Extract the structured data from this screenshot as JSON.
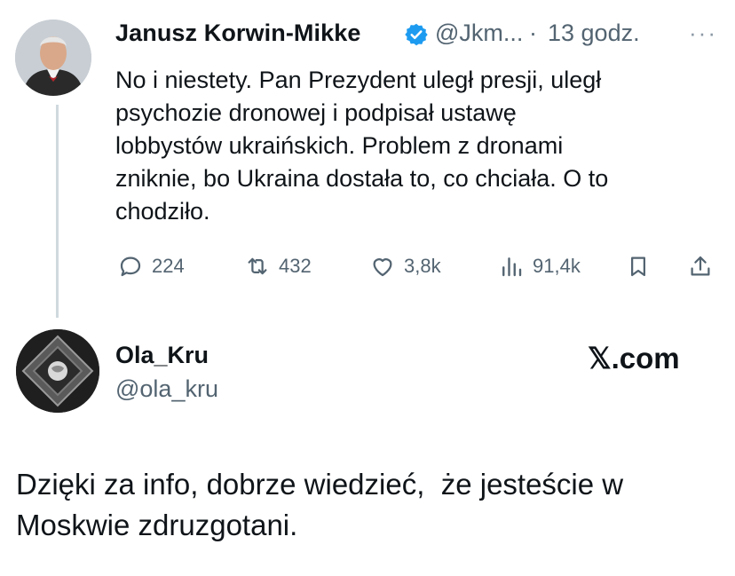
{
  "tweet": {
    "author_name": "Janusz Korwin-Mikke",
    "handle": "@Jkm...",
    "separator": "·",
    "time": "13 godz.",
    "more_label": "···",
    "lines": [
      "No i niestety. Pan Prezydent uległ presji, uległ",
      "psychozie dronowej i podpisał ustawę",
      "lobbystów ukraińskich. Problem z dronami",
      "zniknie, bo Ukraina dostała to, co chciała. O to",
      "chodziło."
    ],
    "replies": "224",
    "reposts": "432",
    "likes": "3,8k",
    "views": "91,4k",
    "icons": [
      "reply-icon",
      "repost-icon",
      "like-icon",
      "views-icon",
      "bookmark-icon",
      "share-icon"
    ]
  },
  "reply": {
    "author_name": "Ola_Kru",
    "handle": "@ola_kru",
    "brand": "𝕏.com",
    "lines": [
      "Dzięki za info, dobrze wiedzieć,  że jesteście w",
      "Moskwie zdruzgotani."
    ]
  },
  "colors": {
    "text": "#0f1419",
    "secondary": "#536471",
    "verified": "#1d9bf0",
    "thread_line": "#cfd9de"
  }
}
